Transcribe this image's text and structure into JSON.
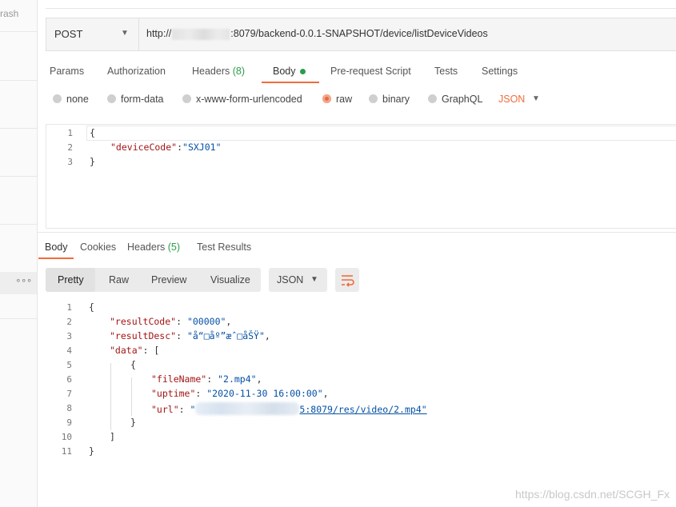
{
  "sidebar": {
    "fragment_text": "rash",
    "more_label": "∘∘∘"
  },
  "request": {
    "method": "POST",
    "url_prefix": "http://",
    "url_suffix": ":8079/backend-0.0.1-SNAPSHOT/device/listDeviceVideos"
  },
  "request_tabs": [
    {
      "label": "Params"
    },
    {
      "label": "Authorization"
    },
    {
      "label": "Headers",
      "count": "(8)"
    },
    {
      "label": "Body"
    },
    {
      "label": "Pre-request Script"
    },
    {
      "label": "Tests"
    },
    {
      "label": "Settings"
    }
  ],
  "body_types": {
    "options": [
      "none",
      "form-data",
      "x-www-form-urlencoded",
      "raw",
      "binary",
      "GraphQL"
    ],
    "selected": "raw",
    "language": "JSON"
  },
  "request_body": {
    "line_numbers": [
      "1",
      "2",
      "3"
    ],
    "open_brace": "{",
    "key": "\"deviceCode\"",
    "colon": ":",
    "value": "\"SXJ01\"",
    "close_brace": "}"
  },
  "response_tabs": [
    {
      "label": "Body"
    },
    {
      "label": "Cookies"
    },
    {
      "label": "Headers",
      "count": "(5)"
    },
    {
      "label": "Test Results"
    }
  ],
  "response_view": {
    "modes": [
      "Pretty",
      "Raw",
      "Preview",
      "Visualize"
    ],
    "active_mode": "Pretty",
    "format": "JSON",
    "wrap_icon": "wrap-lines-icon"
  },
  "response_body": {
    "line_numbers": [
      "1",
      "2",
      "3",
      "4",
      "5",
      "6",
      "7",
      "8",
      "9",
      "10",
      "11"
    ],
    "l1": "{",
    "l2_key": "\"resultCode\"",
    "l2_val": "\"00000\"",
    "l3_key": "\"resultDesc\"",
    "l3_val": "\"å“□åº”æˆ□åŠŸ\"",
    "l4_key": "\"data\"",
    "l4_bracket": "[",
    "l5": "{",
    "l6_key": "\"fileName\"",
    "l6_val": "\"2.mp4\"",
    "l7_key": "\"uptime\"",
    "l7_val": "\"2020-11-30 16:00:00\"",
    "l8_key": "\"url\"",
    "l8_val_prefix": "\"",
    "l8_val_suffix": "5:8079/res/video/2.mp4\"",
    "l9": "}",
    "l10": "]",
    "l11": "}"
  },
  "watermark": "https://blog.csdn.net/SCGH_Fx",
  "colors": {
    "accent": "#f26b3a",
    "count_green": "#2a9d49",
    "json_key": "#a31515",
    "json_string": "#0451a5"
  }
}
